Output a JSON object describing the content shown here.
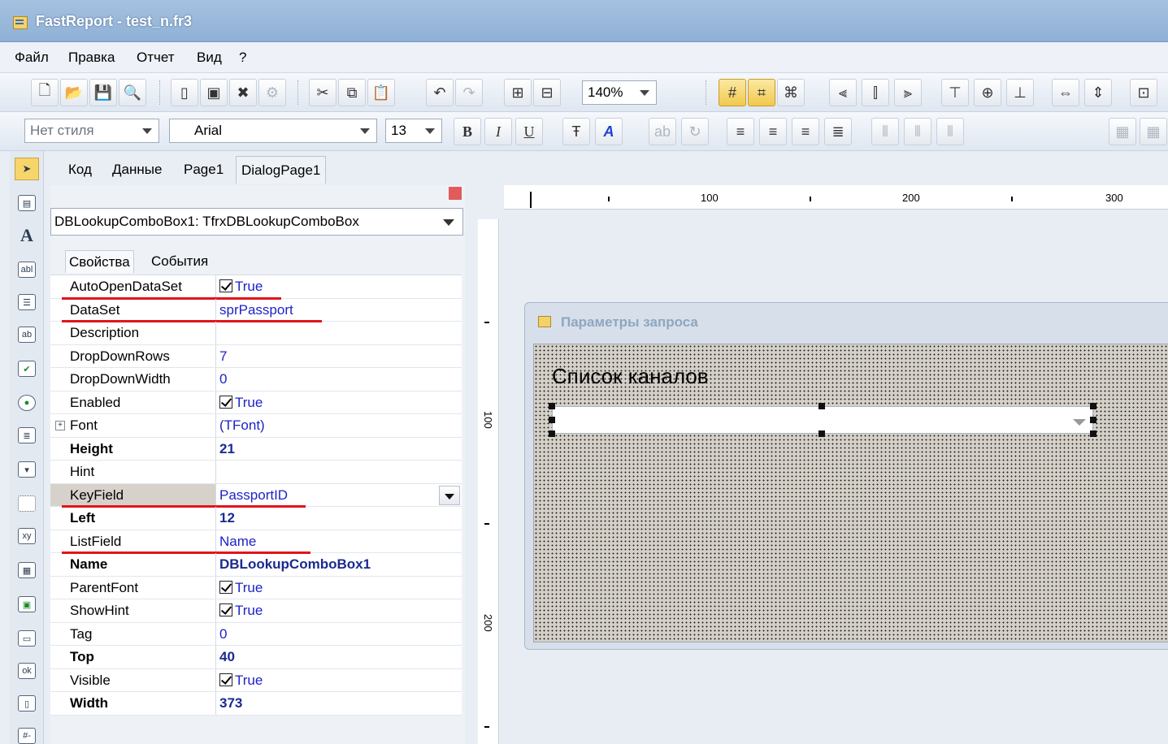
{
  "window": {
    "title": "FastReport - test_n.fr3"
  },
  "menu": [
    "Файл",
    "Правка",
    "Отчет",
    "Вид",
    "?"
  ],
  "toolbar1": {
    "zoom": "140%"
  },
  "toolbar2": {
    "style_value": "Нет стиля",
    "font_value": "Arial",
    "size_value": "13",
    "bold": "B",
    "italic": "I",
    "underline": "U"
  },
  "tabs": [
    "Код",
    "Данные",
    "Page1",
    "DialogPage1"
  ],
  "inspector": {
    "object": "DBLookupComboBox1: TfrxDBLookupComboBox",
    "prop_tabs": [
      "Свойства",
      "События"
    ],
    "rows": [
      {
        "name": "AutoOpenDataSet",
        "value": "True",
        "check": true
      },
      {
        "name": "DataSet",
        "value": "sprPassport"
      },
      {
        "name": "Description",
        "value": ""
      },
      {
        "name": "DropDownRows",
        "value": "7"
      },
      {
        "name": "DropDownWidth",
        "value": "0"
      },
      {
        "name": "Enabled",
        "value": "True",
        "check": true
      },
      {
        "name": "Font",
        "value": "(TFont)",
        "expand": true
      },
      {
        "name": "Height",
        "value": "21",
        "bold": true
      },
      {
        "name": "Hint",
        "value": ""
      },
      {
        "name": "KeyField",
        "value": "PassportID",
        "selected": true
      },
      {
        "name": "Left",
        "value": "12",
        "bold": true
      },
      {
        "name": "ListField",
        "value": "Name"
      },
      {
        "name": "Name",
        "value": "DBLookupComboBox1",
        "bold": true
      },
      {
        "name": "ParentFont",
        "value": "True",
        "check": true
      },
      {
        "name": "ShowHint",
        "value": "True",
        "check": true
      },
      {
        "name": "Tag",
        "value": "0"
      },
      {
        "name": "Top",
        "value": "40",
        "bold": true
      },
      {
        "name": "Visible",
        "value": "True",
        "check": true
      },
      {
        "name": "Width",
        "value": "373",
        "bold": true
      }
    ]
  },
  "ruler": {
    "h_labels": [
      "100",
      "200",
      "300"
    ],
    "v_labels": [
      "100",
      "200"
    ]
  },
  "dialog": {
    "title": "Параметры запроса",
    "label": "Список каналов"
  },
  "colors": {
    "accent": "#e2141c",
    "title_bar": "#8eb0d6",
    "value_text": "#1c23c9"
  }
}
